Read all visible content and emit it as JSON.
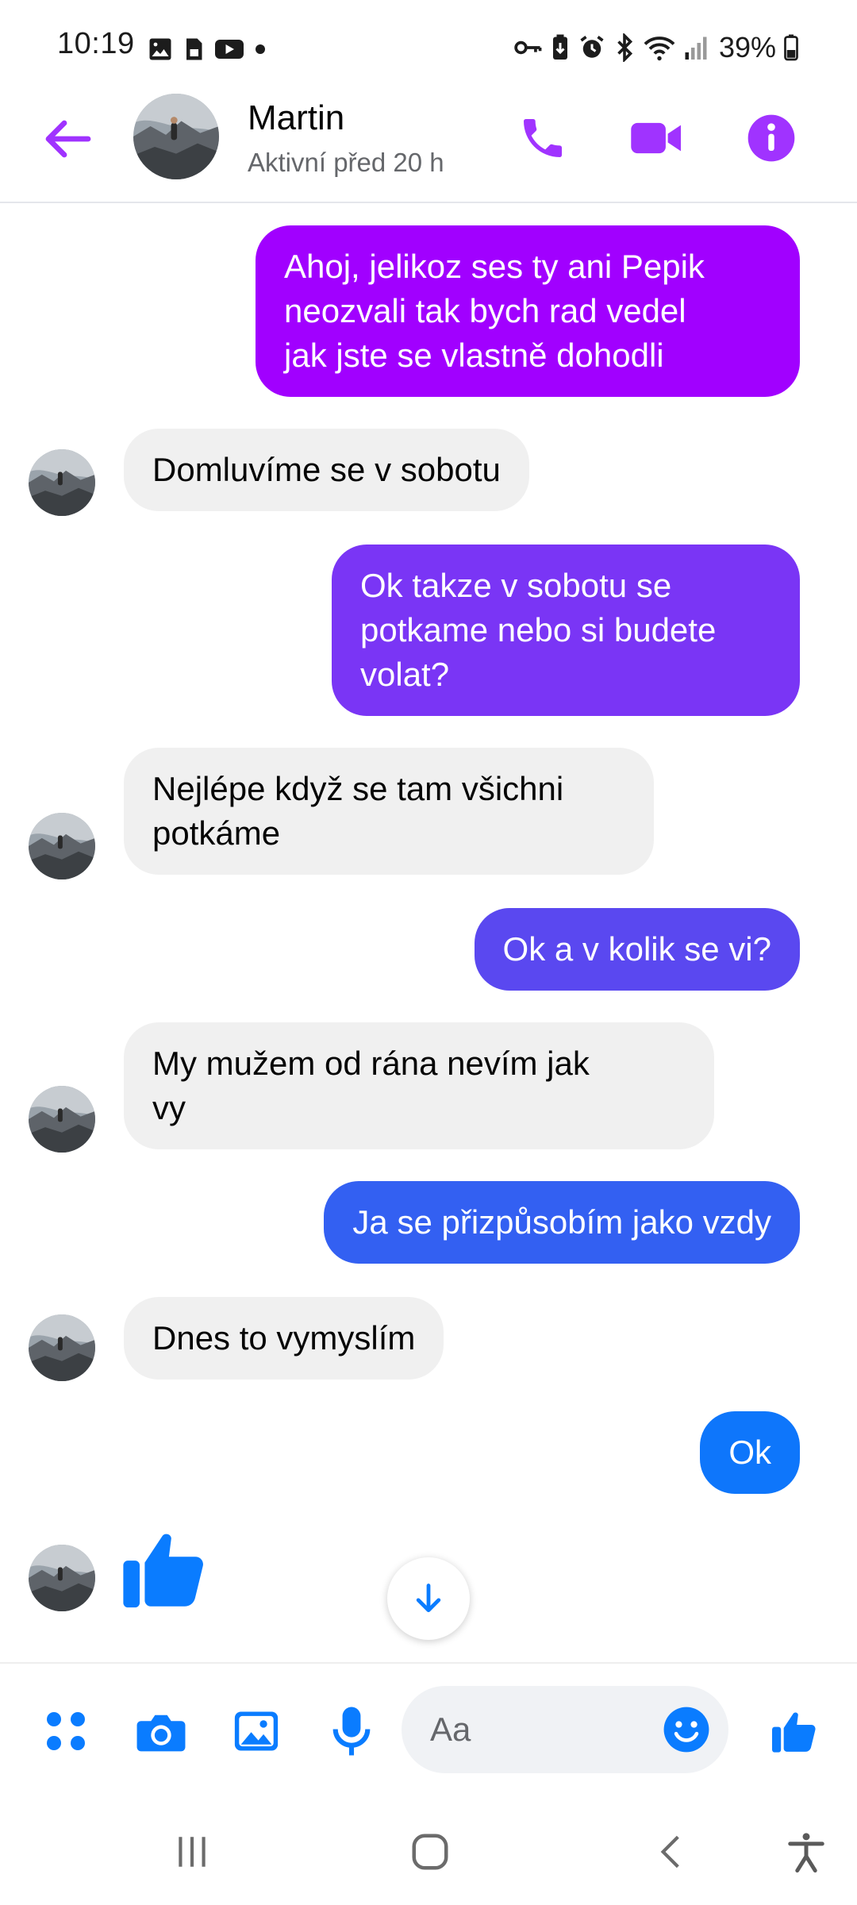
{
  "status_bar": {
    "time": "10:19",
    "battery": "39%",
    "icons": [
      "image-icon",
      "sim-icon",
      "youtube-icon",
      "dot-icon",
      "vpn-key-icon",
      "battery-saver-icon",
      "alarm-icon",
      "bluetooth-icon",
      "wifi-icon",
      "signal-icon",
      "battery-icon"
    ]
  },
  "header": {
    "name": "Martin",
    "status": "Aktivní před 20 h"
  },
  "colors": {
    "accent": "#a033ff",
    "blue": "#0a7cff",
    "bubble_gradient": [
      "#a100ff",
      "#7a35f5",
      "#5a48f0",
      "#3360f2",
      "#0e76fb"
    ],
    "incoming_bubble": "#f0f0f0"
  },
  "messages": [
    {
      "direction": "out",
      "lines": [
        "Ahoj, jelikoz ses ty ani Pepik",
        "neozvali tak bych rad vedel",
        "jak jste se vlastně dohodli"
      ]
    },
    {
      "direction": "in",
      "lines": [
        "Domluvíme se v sobotu"
      ]
    },
    {
      "direction": "out",
      "lines": [
        "Ok takze v sobotu se",
        "potkame nebo si budete",
        "volat?"
      ]
    },
    {
      "direction": "in",
      "lines": [
        "Nejlépe když se tam všichni",
        "potkáme"
      ]
    },
    {
      "direction": "out",
      "lines": [
        "Ok a v kolik se vi?"
      ]
    },
    {
      "direction": "in",
      "lines": [
        "My mužem od rána nevím jak",
        "vy"
      ]
    },
    {
      "direction": "out",
      "lines": [
        "Ja se přizpůsobím jako vzdy"
      ]
    },
    {
      "direction": "in",
      "lines": [
        "Dnes to vymyslím"
      ]
    },
    {
      "direction": "out",
      "lines": [
        "Ok"
      ]
    },
    {
      "direction": "in",
      "sticker": "thumbs-up-icon"
    }
  ],
  "composer": {
    "placeholder": "Aa",
    "icons": [
      "apps-icon",
      "camera-icon",
      "gallery-icon",
      "microphone-icon",
      "emoji-icon",
      "like-icon"
    ]
  },
  "navbar": {
    "icons": [
      "recent-apps-icon",
      "home-icon",
      "back-nav-icon",
      "accessibility-icon"
    ]
  }
}
